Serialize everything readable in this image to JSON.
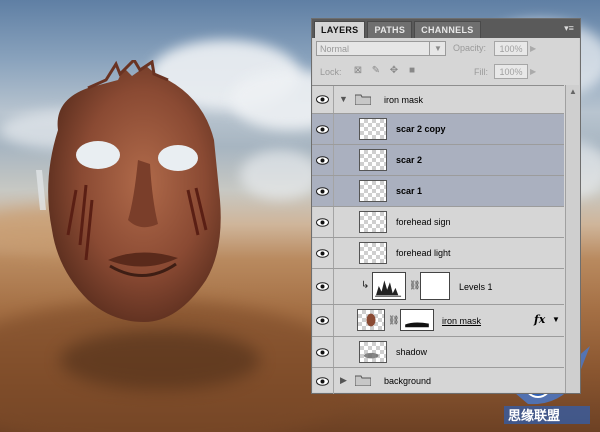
{
  "panel": {
    "tabs": [
      "LAYERS",
      "PATHS",
      "CHANNELS"
    ],
    "menu_icon": "panel-menu-icon",
    "blend_mode": "Normal",
    "opacity_label": "Opacity:",
    "opacity_value": "100%",
    "lock_label": "Lock:",
    "fill_label": "Fill:",
    "fill_value": "100%"
  },
  "layers": [
    {
      "name": "iron mask",
      "kind": "group",
      "expanded": true
    },
    {
      "name": "scar 2 copy",
      "kind": "layer",
      "selected": true
    },
    {
      "name": "scar 2",
      "kind": "layer",
      "selected": true
    },
    {
      "name": "scar 1",
      "kind": "layer",
      "selected": true
    },
    {
      "name": "forehead sign",
      "kind": "layer",
      "selected": false
    },
    {
      "name": "forehead light",
      "kind": "layer",
      "selected": false
    },
    {
      "name": "Levels 1",
      "kind": "adjustment",
      "selected": false
    },
    {
      "name": "iron mask",
      "kind": "masked-layer",
      "selected": false,
      "effects": "fx"
    },
    {
      "name": "shadow",
      "kind": "layer",
      "selected": false
    },
    {
      "name": "background",
      "kind": "group",
      "expanded": false
    }
  ],
  "colors": {
    "selected_row": "#aab0bf",
    "panel_bg": "#d6d6d6",
    "tab_bar": "#5a5a5a"
  }
}
